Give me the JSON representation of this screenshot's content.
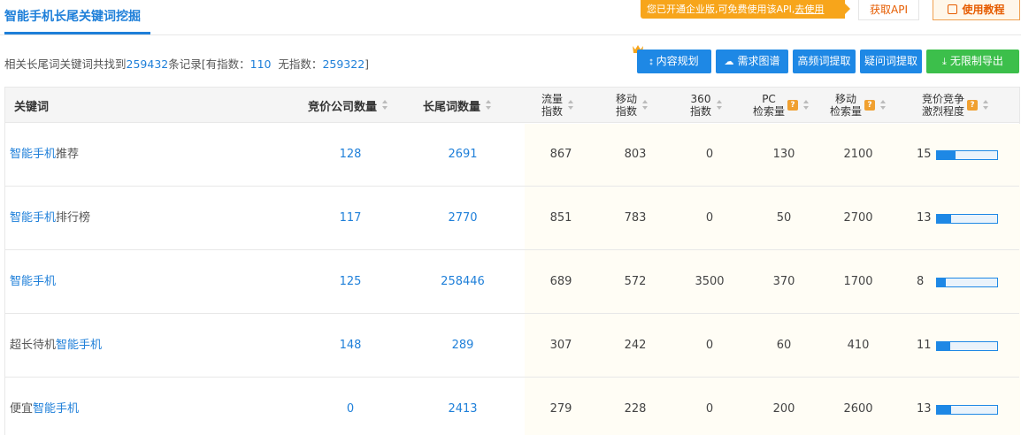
{
  "tab": {
    "highlight": "智能手机",
    "rest": "长尾关键词挖掘"
  },
  "notice": {
    "text": "您已开通企业版,可免费使用该API,",
    "link": "去使用"
  },
  "buttons": {
    "get_api": "获取API",
    "tutorial": "使用教程"
  },
  "summary": {
    "prefix": "相关长尾词关键词共找到",
    "total": "259432",
    "mid": "条记录[有指数：",
    "with_index": "110",
    "mid2": "  无指数：",
    "without_index": "259322",
    "suffix": "]"
  },
  "tools": [
    {
      "label": "内容规划",
      "icon": "share-icon"
    },
    {
      "label": "需求图谱",
      "icon": "cloud-icon"
    },
    {
      "label": "高频词提取"
    },
    {
      "label": "疑问词提取"
    },
    {
      "label": "无限制导出",
      "icon": "download-icon"
    }
  ],
  "columns": {
    "keyword": "关键词",
    "bid_companies": "竞价公司数量",
    "longtail_count": "长尾词数量",
    "traffic_index": [
      "流量",
      "指数"
    ],
    "mobile_index": [
      "移动",
      "指数"
    ],
    "index_360": [
      "360",
      "指数"
    ],
    "pc_search": [
      "PC",
      "检索量"
    ],
    "mobile_search": [
      "移动",
      "检索量"
    ],
    "competition": [
      "竞价竞争",
      "激烈程度"
    ],
    "help_mark": "?"
  },
  "rows": [
    {
      "kw_pre": "",
      "kw_hl": "智能手机",
      "kw_post": "推荐",
      "bid": "128",
      "longtail": "2691",
      "traffic": "867",
      "mobile": "803",
      "i360": "0",
      "pc": "130",
      "msearch": "2100",
      "comp": "15",
      "comp_level": 0.31
    },
    {
      "kw_pre": "",
      "kw_hl": "智能手机",
      "kw_post": "排行榜",
      "bid": "117",
      "longtail": "2770",
      "traffic": "851",
      "mobile": "783",
      "i360": "0",
      "pc": "50",
      "msearch": "2700",
      "comp": "13",
      "comp_level": 0.24
    },
    {
      "kw_pre": "",
      "kw_hl": "智能手机",
      "kw_post": "",
      "bid": "125",
      "longtail": "258446",
      "traffic": "689",
      "mobile": "572",
      "i360": "3500",
      "pc": "370",
      "msearch": "1700",
      "comp": "8",
      "comp_level": 0.15
    },
    {
      "kw_pre": "超长待机",
      "kw_hl": "智能手机",
      "kw_post": "",
      "bid": "148",
      "longtail": "289",
      "traffic": "307",
      "mobile": "242",
      "i360": "0",
      "pc": "60",
      "msearch": "410",
      "comp": "11",
      "comp_level": 0.22
    },
    {
      "kw_pre": "便宜",
      "kw_hl": "智能手机",
      "kw_post": "",
      "bid": "0",
      "longtail": "2413",
      "traffic": "279",
      "mobile": "228",
      "i360": "0",
      "pc": "200",
      "msearch": "2600",
      "comp": "13",
      "comp_level": 0.24
    }
  ]
}
